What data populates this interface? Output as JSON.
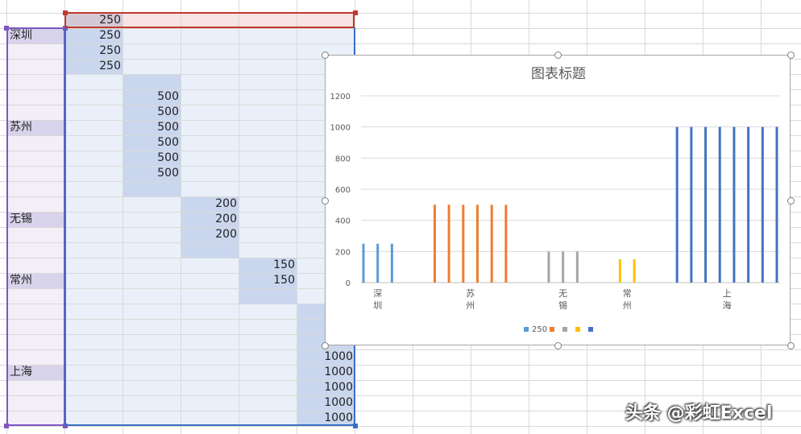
{
  "sheet": {
    "header_value": "250",
    "categories": [
      {
        "label": "深圳",
        "row": 1
      },
      {
        "label": "苏州",
        "row": 7
      },
      {
        "label": "无锡",
        "row": 13
      },
      {
        "label": "常州",
        "row": 17
      },
      {
        "label": "上海",
        "row": 23
      }
    ],
    "cells": [
      {
        "row": 1,
        "col": 0,
        "value": "250"
      },
      {
        "row": 2,
        "col": 0,
        "value": "250"
      },
      {
        "row": 3,
        "col": 0,
        "value": "250"
      },
      {
        "row": 5,
        "col": 1,
        "value": "500"
      },
      {
        "row": 6,
        "col": 1,
        "value": "500"
      },
      {
        "row": 7,
        "col": 1,
        "value": "500"
      },
      {
        "row": 8,
        "col": 1,
        "value": "500"
      },
      {
        "row": 9,
        "col": 1,
        "value": "500"
      },
      {
        "row": 10,
        "col": 1,
        "value": "500"
      },
      {
        "row": 12,
        "col": 2,
        "value": "200"
      },
      {
        "row": 13,
        "col": 2,
        "value": "200"
      },
      {
        "row": 14,
        "col": 2,
        "value": "200"
      },
      {
        "row": 16,
        "col": 3,
        "value": "150"
      },
      {
        "row": 17,
        "col": 3,
        "value": "150"
      },
      {
        "row": 22,
        "col": 4,
        "value": "1000"
      },
      {
        "row": 23,
        "col": 4,
        "value": "1000"
      },
      {
        "row": 24,
        "col": 4,
        "value": "1000"
      },
      {
        "row": 25,
        "col": 4,
        "value": "1000"
      },
      {
        "row": 26,
        "col": 4,
        "value": "1000"
      }
    ]
  },
  "chart_data": {
    "type": "bar",
    "title": "图表标题",
    "ylim": [
      0,
      1200
    ],
    "yticks": [
      0,
      200,
      400,
      600,
      800,
      1000,
      1200
    ],
    "grid": true,
    "legend_position": "bottom",
    "category_groups": [
      "深圳",
      "苏州",
      "无锡",
      "常州",
      "上海"
    ],
    "series": [
      {
        "name": "250",
        "color": "#5b9bd5",
        "values": [
          250,
          250,
          250
        ]
      },
      {
        "name": "",
        "color": "#ed7d31",
        "values": [
          500,
          500,
          500,
          500,
          500,
          500
        ]
      },
      {
        "name": "",
        "color": "#a5a5a5",
        "values": [
          200,
          200,
          200
        ]
      },
      {
        "name": "",
        "color": "#ffc000",
        "values": [
          150,
          150
        ]
      },
      {
        "name": "",
        "color": "#4472c4",
        "values": [
          1000,
          1000,
          1000,
          1000,
          1000,
          1000,
          1000,
          1000
        ]
      }
    ]
  },
  "watermark": "头条 @彩虹Excel"
}
